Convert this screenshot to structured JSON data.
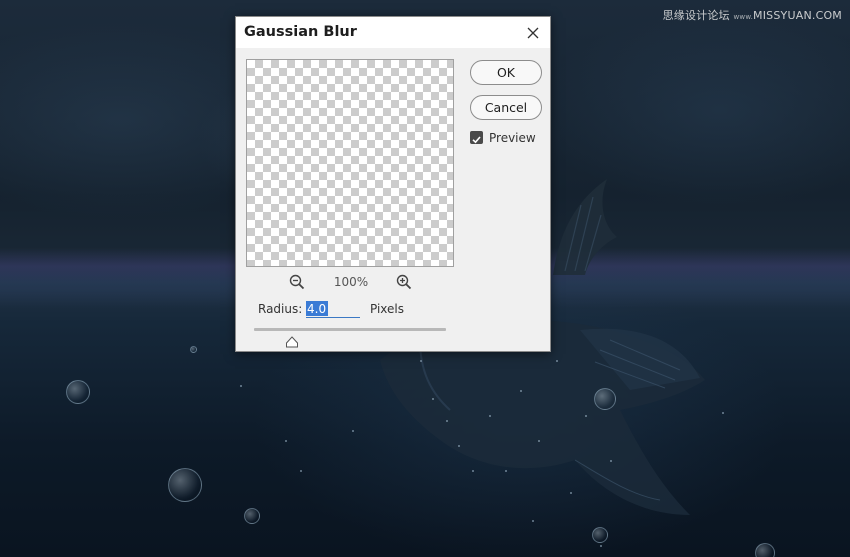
{
  "watermark": {
    "site_cn": "思缘设计论坛",
    "separator": "www.",
    "site_url": "MISSYUAN.COM"
  },
  "dialog": {
    "title": "Gaussian Blur",
    "ok_label": "OK",
    "cancel_label": "Cancel",
    "preview_label": "Preview",
    "preview_checked": true,
    "zoom_level": "100%",
    "radius_label": "Radius:",
    "radius_value": "4.0",
    "radius_unit": "Pixels",
    "slider_position_fraction": 0.2
  },
  "icons": {
    "close": "close-icon",
    "zoom_out": "zoom-out-icon",
    "zoom_in": "zoom-in-icon",
    "checkbox": "checkmark-icon",
    "slider": "slider-handle-icon"
  },
  "colors": {
    "dialog_bg": "#f0f0f0",
    "selection": "#3a7bd5",
    "scene_dark": "#0e1a26"
  }
}
